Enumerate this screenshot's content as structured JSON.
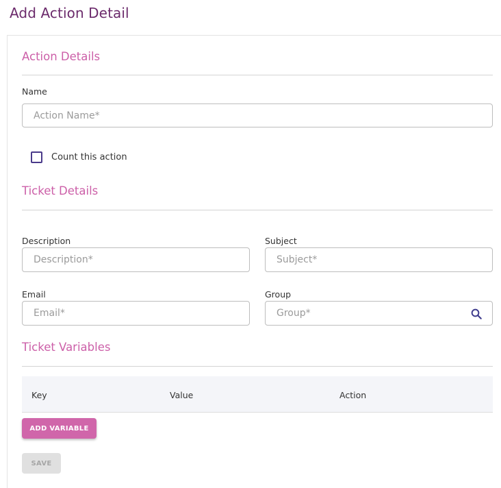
{
  "page": {
    "title": "Add Action Detail"
  },
  "action_details": {
    "title": "Action Details",
    "name_label": "Name",
    "name_placeholder": "Action Name*",
    "count_label": "Count this action"
  },
  "ticket_details": {
    "title": "Ticket Details",
    "description_label": "Description",
    "description_placeholder": "Description*",
    "subject_label": "Subject",
    "subject_placeholder": "Subject*",
    "email_label": "Email",
    "email_placeholder": "Email*",
    "group_label": "Group",
    "group_placeholder": "Group*",
    "group_icon": "search-icon"
  },
  "ticket_variables": {
    "title": "Ticket Variables",
    "columns": [
      "Key",
      "Value",
      "Action"
    ],
    "add_button": "ADD VARIABLE"
  },
  "footer": {
    "save_button": "SAVE"
  },
  "colors": {
    "title": "#6b2a6b",
    "section": "#cc5fa8",
    "primary_button": "#d066aa",
    "checkbox_border": "#4a3a8a"
  }
}
